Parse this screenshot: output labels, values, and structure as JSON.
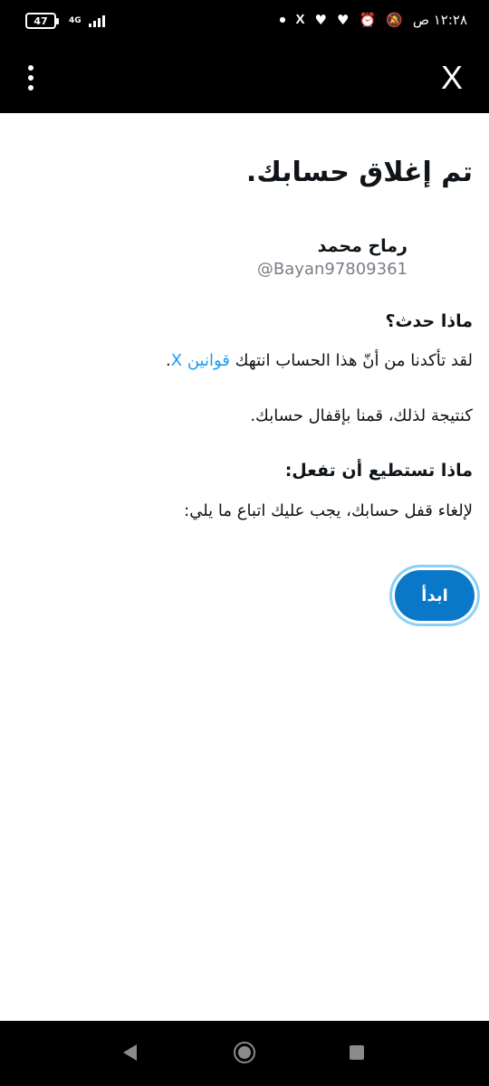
{
  "status_bar": {
    "time": "١٢:٢٨ ص",
    "battery": "47",
    "network": "4G",
    "icons": [
      "alarm-icon",
      "mute-icon",
      "heart-icon",
      "heart-icon",
      "x-logo-icon",
      "dot-icon"
    ]
  },
  "app_bar": {
    "close_label": "X",
    "menu_icon": "kebab-menu-icon"
  },
  "page": {
    "title": "تم إغلاق حسابك.",
    "user_name": "رماح محمد",
    "user_handle": "@Bayan97809361",
    "what_happened_heading": "ماذا حدث؟",
    "violation_text": "لقد تأكدنا من أنّ هذا الحساب انتهك ",
    "rules_link": "قوانين X",
    "violation_end": ".",
    "consequence_text": "كنتيجة لذلك، قمنا بإقفال حسابك.",
    "what_can_you_do_heading": "ماذا تستطيع أن تفعل:",
    "instructions_text": "لإلغاء قفل حسابك، يجب عليك اتباع ما يلي:",
    "start_button": "ابدأ"
  },
  "colors": {
    "link": "#1d9bf0",
    "button": "#0a78c8",
    "handle": "#777f88"
  }
}
